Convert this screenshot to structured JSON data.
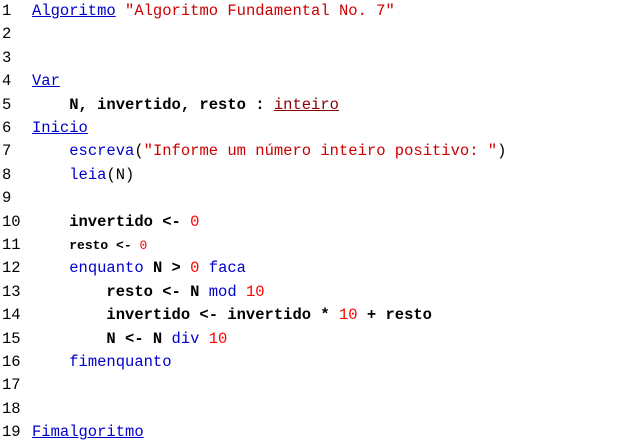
{
  "editor": {
    "lines": [
      {
        "num": "1",
        "parts": [
          {
            "t": "Algoritmo",
            "c": "kw-ul"
          },
          {
            "t": " ",
            "c": "plain"
          },
          {
            "t": "\"Algoritmo Fundamental No. 7\"",
            "c": "str"
          }
        ]
      },
      {
        "num": "2",
        "parts": []
      },
      {
        "num": "3",
        "parts": []
      },
      {
        "num": "4",
        "parts": [
          {
            "t": "Var",
            "c": "kw-ul"
          }
        ]
      },
      {
        "num": "5",
        "parts": [
          {
            "t": "    N, invertido, resto : ",
            "c": "plain bold"
          },
          {
            "t": "inteiro",
            "c": "type"
          }
        ]
      },
      {
        "num": "6",
        "parts": [
          {
            "t": "Inicio",
            "c": "kw-ul"
          }
        ]
      },
      {
        "num": "7",
        "parts": [
          {
            "t": "    ",
            "c": "plain"
          },
          {
            "t": "escreva",
            "c": "fn"
          },
          {
            "t": "(",
            "c": "plain"
          },
          {
            "t": "\"Informe um número inteiro positivo: \"",
            "c": "str"
          },
          {
            "t": ")",
            "c": "plain"
          }
        ]
      },
      {
        "num": "8",
        "parts": [
          {
            "t": "    ",
            "c": "plain"
          },
          {
            "t": "leia",
            "c": "fn"
          },
          {
            "t": "(N)",
            "c": "plain"
          }
        ]
      },
      {
        "num": "9",
        "parts": []
      },
      {
        "num": "10",
        "parts": [
          {
            "t": "    invertido <- ",
            "c": "plain bold"
          },
          {
            "t": "0",
            "c": "num"
          }
        ]
      },
      {
        "num": "11",
        "parts": [
          {
            "t": "    ",
            "c": "plain"
          },
          {
            "t": "resto <- ",
            "c": "plain bold small"
          },
          {
            "t": "0",
            "c": "num small"
          }
        ]
      },
      {
        "num": "12",
        "parts": [
          {
            "t": "    ",
            "c": "plain"
          },
          {
            "t": "enquanto",
            "c": "fn"
          },
          {
            "t": " N > ",
            "c": "plain bold"
          },
          {
            "t": "0",
            "c": "num"
          },
          {
            "t": " ",
            "c": "plain"
          },
          {
            "t": "faca",
            "c": "fn"
          }
        ]
      },
      {
        "num": "13",
        "parts": [
          {
            "t": "        resto <- N ",
            "c": "plain bold"
          },
          {
            "t": "mod",
            "c": "op"
          },
          {
            "t": " ",
            "c": "plain"
          },
          {
            "t": "10",
            "c": "num"
          }
        ]
      },
      {
        "num": "14",
        "parts": [
          {
            "t": "        invertido <- invertido * ",
            "c": "plain bold"
          },
          {
            "t": "10",
            "c": "num"
          },
          {
            "t": " + resto",
            "c": "plain bold"
          }
        ]
      },
      {
        "num": "15",
        "parts": [
          {
            "t": "        N <- N ",
            "c": "plain bold"
          },
          {
            "t": "div",
            "c": "op"
          },
          {
            "t": " ",
            "c": "plain"
          },
          {
            "t": "10",
            "c": "num"
          }
        ]
      },
      {
        "num": "16",
        "parts": [
          {
            "t": "    ",
            "c": "plain"
          },
          {
            "t": "fimenquanto",
            "c": "fn"
          }
        ]
      },
      {
        "num": "17",
        "parts": []
      },
      {
        "num": "18",
        "parts": []
      },
      {
        "num": "19",
        "parts": [
          {
            "t": "Fimalgoritmo",
            "c": "kw-ul"
          }
        ]
      }
    ]
  }
}
